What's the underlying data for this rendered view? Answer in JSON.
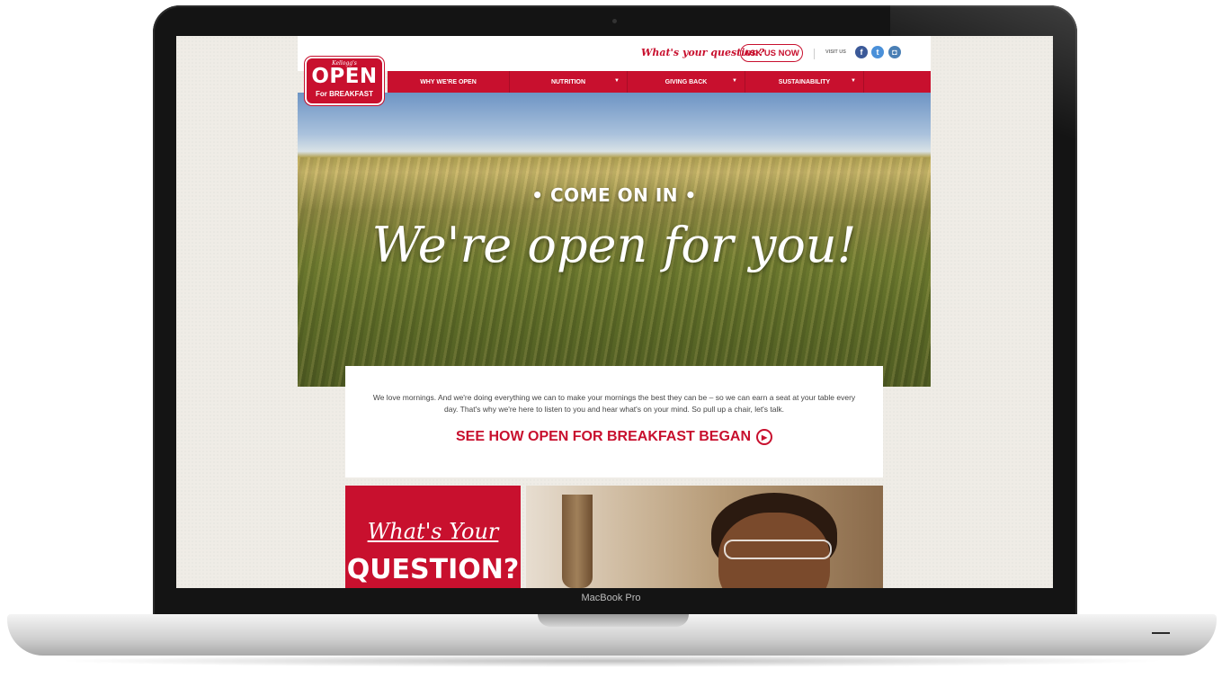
{
  "device": {
    "model_label": "MacBook Pro"
  },
  "site": {
    "topbar": {
      "question": "What's your question?",
      "ask_button": "ASK US NOW",
      "visit_label": "VISIT US",
      "social": [
        {
          "name": "facebook-icon",
          "glyph": "f"
        },
        {
          "name": "twitter-icon",
          "glyph": "t"
        },
        {
          "name": "instagram-icon",
          "glyph": "◘"
        }
      ]
    },
    "logo": {
      "brand": "Kellogg's",
      "line1": "OPEN",
      "line2": "For BREAKFAST"
    },
    "nav": [
      {
        "label": "WHY WE'RE OPEN",
        "dropdown": false
      },
      {
        "label": "NUTRITION",
        "dropdown": true
      },
      {
        "label": "GIVING BACK",
        "dropdown": true
      },
      {
        "label": "SUSTAINABILITY",
        "dropdown": true
      }
    ],
    "hero": {
      "subtitle": "• COME ON IN •",
      "title": "We're open for you!"
    },
    "intro": {
      "text": "We love mornings. And we're doing everything we can to make your mornings the best they can be – so we can earn a seat at your table every day. That's why we're here to listen to you and hear what's on your mind. So pull up a chair, let's talk.",
      "cta": "SEE HOW OPEN FOR BREAKFAST BEGAN"
    },
    "tiles": {
      "question_line1": "What's Your",
      "question_line2": "QUESTION?"
    },
    "colors": {
      "brand_red": "#c8102e",
      "facebook": "#3b5998",
      "twitter": "#4a90d9"
    }
  }
}
